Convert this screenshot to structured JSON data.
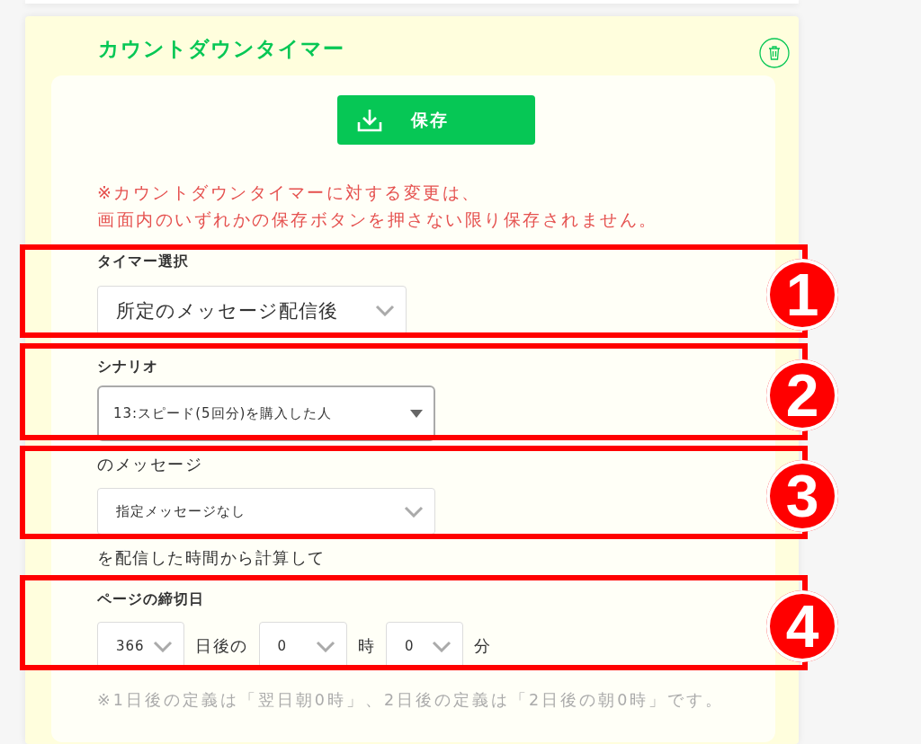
{
  "card": {
    "title": "カウントダウンタイマー",
    "save_button": {
      "label": "保存"
    },
    "notice": [
      "※カウントダウンタイマーに対する変更は、",
      "画面内のいずれかの保存ボタンを押さない限り保存されません。"
    ],
    "timer_select": {
      "label": "タイマー選択",
      "value": "所定のメッセージ配信後"
    },
    "scenario": {
      "label": "シナリオ",
      "value": "13:スピード(5回分)を購入した人"
    },
    "message": {
      "label": "のメッセージ",
      "value": "指定メッセージなし"
    },
    "message_suffix": "を配信した時間から計算して",
    "deadline": {
      "label": "ページの締切日",
      "days": "366",
      "days_unit": "日後の",
      "hours": "0",
      "hours_unit": "時",
      "minutes": "0",
      "minutes_unit": "分"
    },
    "footnote": "※1日後の定義は「翌日朝0時」、2日後の定義は「2日後の朝0時」です。"
  },
  "annotations": [
    {
      "number": "1"
    },
    {
      "number": "2"
    },
    {
      "number": "3"
    },
    {
      "number": "4"
    }
  ]
}
